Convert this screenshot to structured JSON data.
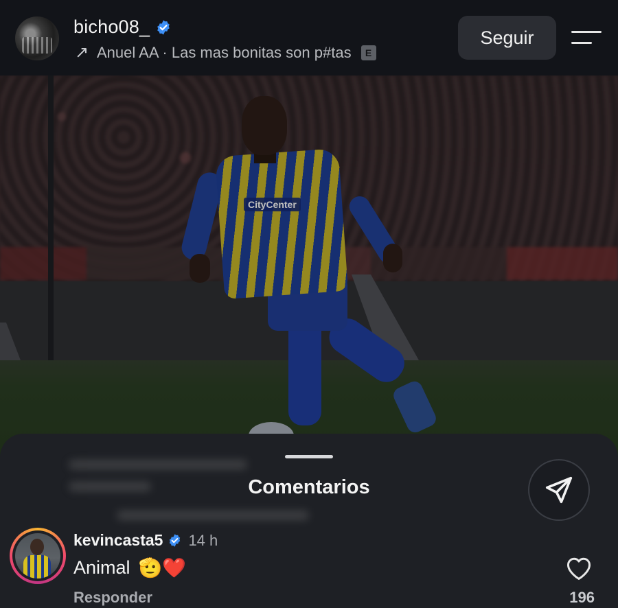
{
  "header": {
    "username": "bicho08_",
    "verified": true,
    "song": {
      "artist_title": "Anuel AA · Las mas bonitas son p#tas",
      "explicit_label": "E"
    },
    "follow_label": "Seguir"
  },
  "post": {
    "jersey_sponsor": "CityCenter"
  },
  "comments_sheet": {
    "title": "Comentarios",
    "comment": {
      "username": "kevincasta5",
      "verified": true,
      "time": "14 h",
      "text": "Animal",
      "emojis": "🫡❤️",
      "reply_label": "Responder",
      "likes": "196"
    }
  },
  "colors": {
    "verified_badge": "#3d8ff5",
    "story_ring": [
      "#f8b532",
      "#f04a6b",
      "#c13584"
    ],
    "sheet_bg": "#1e2025",
    "header_bg": "#121419"
  },
  "icons": [
    "verified-icon",
    "music-arrow-icon",
    "explicit-icon",
    "menu-icon",
    "share-send-icon",
    "heart-icon"
  ]
}
